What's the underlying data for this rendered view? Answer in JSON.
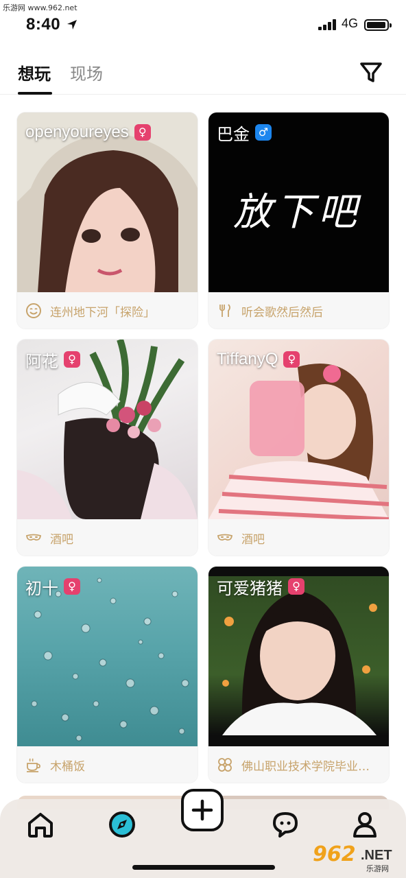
{
  "watermark": {
    "site": "乐游网 www.962.net",
    "logo_big": "962",
    "logo_net": ".NET",
    "logo_sub": "乐游网"
  },
  "status_bar": {
    "time": "8:40",
    "network": "4G"
  },
  "tabs": [
    {
      "label": "想玩",
      "active": true
    },
    {
      "label": "现场",
      "active": false
    }
  ],
  "colors": {
    "accent_text": "#c7a36b",
    "female": "#e5416e",
    "male": "#1c86ee"
  },
  "cards": [
    {
      "name": "openyoureyes",
      "gender": "♀",
      "gender_type": "female",
      "activity": "连州地下河「探险」",
      "icon": "smile-icon"
    },
    {
      "name": "巴金",
      "gender": "♂",
      "gender_type": "male",
      "activity": "听会歌然后然后",
      "icon": "dining-icon",
      "photo_text": "放下吧"
    },
    {
      "name": "阿花",
      "gender": "♀",
      "gender_type": "female",
      "activity": "酒吧",
      "icon": "mask-icon"
    },
    {
      "name": "TiffanyQ",
      "gender": "♀",
      "gender_type": "female",
      "activity": "酒吧",
      "icon": "mask-icon"
    },
    {
      "name": "初十",
      "gender": "♀",
      "gender_type": "female",
      "activity": "木桶饭",
      "icon": "coffee-cup-icon"
    },
    {
      "name": "可爱猪猪",
      "gender": "♀",
      "gender_type": "female",
      "activity": "佛山职业技术学院毕业…",
      "icon": "flower-icon"
    }
  ],
  "nav": [
    "home-icon",
    "compass-icon",
    "add-icon",
    "chat-icon",
    "profile-icon"
  ]
}
